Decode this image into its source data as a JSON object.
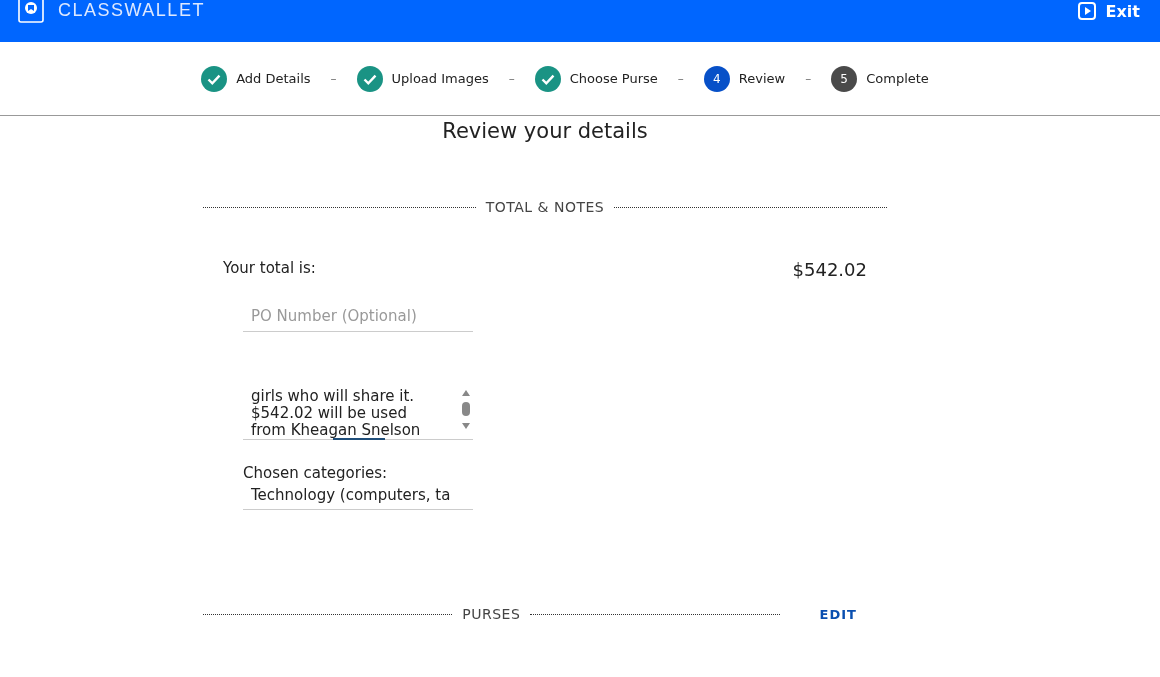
{
  "header": {
    "brand": "CLASSWALLET",
    "exit_label": "Exit"
  },
  "steps": [
    {
      "label": "Add Details",
      "completed": true,
      "selected": false
    },
    {
      "label": "Upload Images",
      "completed": true,
      "selected": false
    },
    {
      "label": "Choose Purse",
      "completed": true,
      "selected": false
    },
    {
      "label": "Review",
      "number": "4",
      "completed": false,
      "selected": true
    },
    {
      "label": "Complete",
      "number": "5",
      "completed": false,
      "selected": false
    }
  ],
  "step_separator": "–",
  "page_title": "Review your details",
  "total_section": {
    "heading": "TOTAL & NOTES",
    "total_label": "Your total is:",
    "total_value": "$542.02",
    "po_field": {
      "placeholder": "PO Number (Optional)"
    },
    "notes_lines": [
      "girls who will share it.",
      "$542.02 will be used",
      "from Kheagan Snelson"
    ],
    "categories_label": "Chosen categories:",
    "categories_value": "Technology (computers, ta"
  },
  "purses_section": {
    "heading": "PURSES",
    "edit_label": "EDIT"
  }
}
